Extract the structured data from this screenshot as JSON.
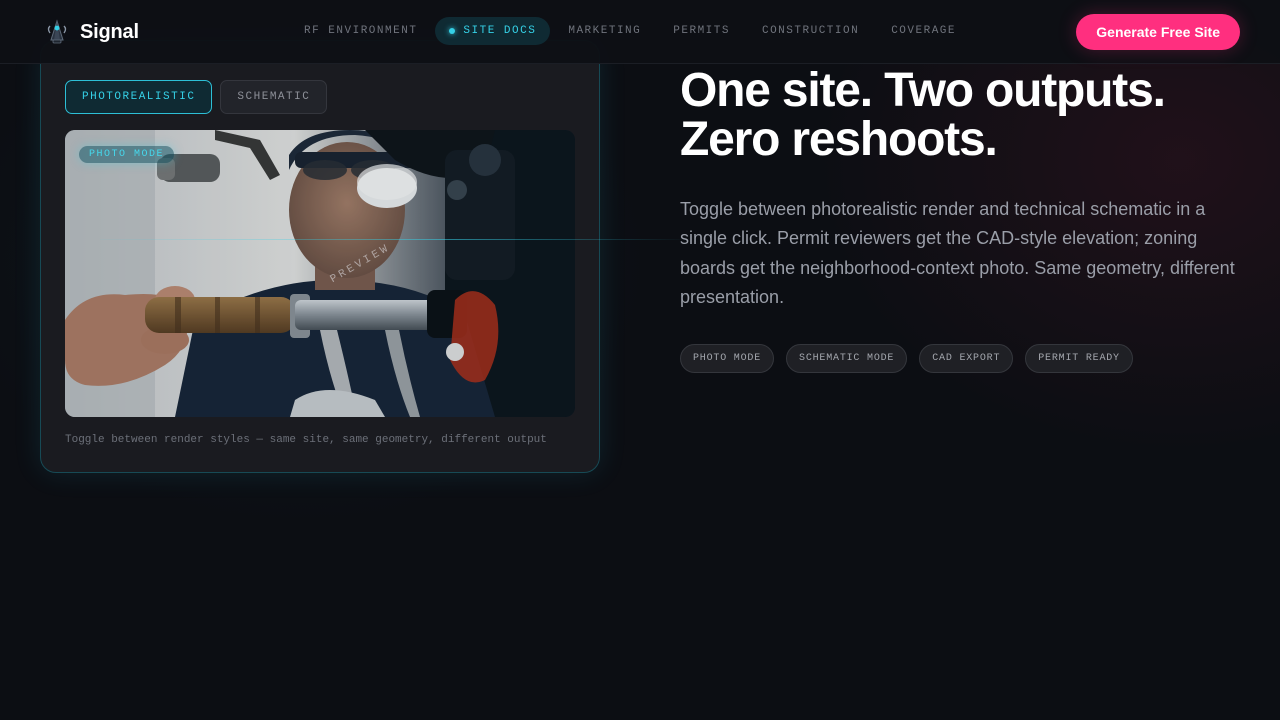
{
  "brand": {
    "name": "Signal",
    "icon": "signal-tower-icon"
  },
  "nav": {
    "links": [
      {
        "label": "RF ENVIRONMENT",
        "active": false
      },
      {
        "label": "SITE DOCS",
        "active": true
      },
      {
        "label": "MARKETING",
        "active": false
      },
      {
        "label": "PERMITS",
        "active": false
      },
      {
        "label": "CONSTRUCTION",
        "active": false
      },
      {
        "label": "COVERAGE",
        "active": false
      }
    ],
    "cta_label": "Generate Free Site"
  },
  "card": {
    "toggles": [
      {
        "label": "PHOTOREALISTIC",
        "active": true
      },
      {
        "label": "SCHEMATIC",
        "active": false
      }
    ],
    "photo_badge": "PHOTO MODE",
    "watermark": "PREVIEW",
    "caption": "Toggle between render styles — same site, same geometry, different output"
  },
  "hero": {
    "headline_line1": "One site. Two outputs.",
    "headline_line2": "Zero reshoots.",
    "description": "Toggle between photorealistic render and technical schematic in a single click. Permit reviewers get the CAD-style elevation; zoning boards get the neighborhood-context photo. Same geometry, different presentation.",
    "tags": [
      "PHOTO MODE",
      "SCHEMATIC MODE",
      "CAD EXPORT",
      "PERMIT READY"
    ]
  },
  "colors": {
    "accent_cyan": "#35d0e6",
    "accent_pink": "#ff2f7f",
    "background": "#0c0e13"
  }
}
